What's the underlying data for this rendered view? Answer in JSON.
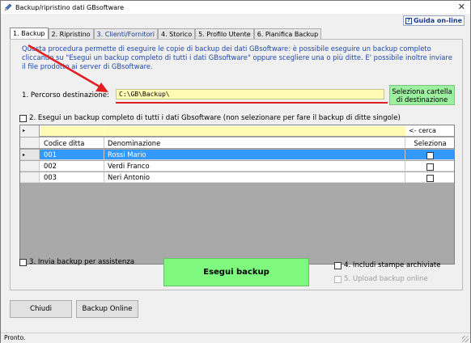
{
  "window": {
    "title": "Backup/ripristino dati GBsoftware",
    "close_glyph": "✕"
  },
  "help_button": {
    "label": "Guida on-line",
    "icon_char": "?"
  },
  "tabs": [
    {
      "label": "1. Backup",
      "active": true,
      "color": "#000000"
    },
    {
      "label": "2. Ripristino",
      "active": false,
      "color": "#000000"
    },
    {
      "label": "3. Clienti/Fornitori",
      "active": false,
      "color": "#1a3c8c"
    },
    {
      "label": "4. Storico",
      "active": false,
      "color": "#000000"
    },
    {
      "label": "5. Profilo Utente",
      "active": false,
      "color": "#000000"
    },
    {
      "label": "6. Pianifica Backup",
      "active": false,
      "color": "#000000"
    }
  ],
  "backup": {
    "description": "Questa procedura permette di eseguire le copie di backup dei dati GBsoftware: è possibile eseguire un backup completo cliccando su \"Esegui un backup completo di tutti i dati GBsoftware\" oppure scegliere una o più ditte. E' possibile inoltre inviare il file prodotto ai server di GBsoftware.",
    "destination_label": "1. Percorso destinazione:",
    "destination_value": "C:\\GB\\Backup\\",
    "select_dest_button": "Seleziona cartella di destinazione",
    "option_full_backup": "2. Esegui un backup completo di tutti i dati Gbsoftware (non selezionare per fare il backup di ditte singole)",
    "search_label": "<- cerca",
    "grid": {
      "columns": [
        "Codice ditta",
        "Denominazione",
        "Seleziona"
      ],
      "rows": [
        {
          "code": "001",
          "name": "Rossi Mario",
          "selected": true
        },
        {
          "code": "002",
          "name": "Verdi Franco",
          "selected": false
        },
        {
          "code": "003",
          "name": "Neri Antonio",
          "selected": false
        }
      ]
    },
    "option_send_assist": "3. Invia backup per assistenza",
    "run_button": "Esegui backup",
    "option_include_prints": "4. Includi stampe archiviate",
    "option_upload_online": "5. Upload backup online"
  },
  "footer": {
    "close_button": "Chiudi",
    "online_button": "Backup Online",
    "status": "Pronto."
  },
  "colors": {
    "accent_green": "#7ef87e",
    "input_yellow": "#fffbb5",
    "selection_blue": "#3399ff",
    "arrow_red": "#e02020",
    "description_blue": "#1d47a8"
  }
}
